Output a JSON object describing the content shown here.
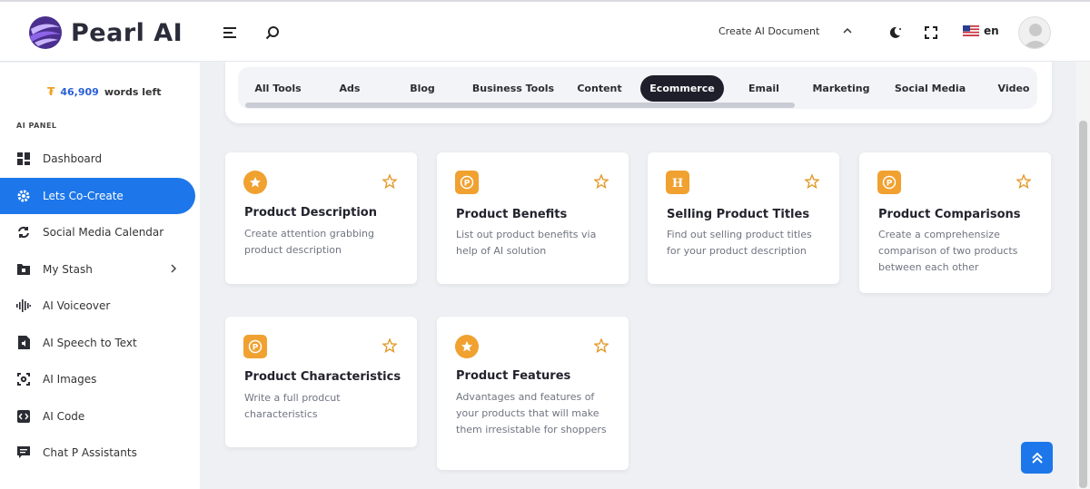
{
  "brand": {
    "name": "Pearl AI"
  },
  "header": {
    "create_document": "Create AI Document",
    "language": "en"
  },
  "sidebar": {
    "words_count": "46,909",
    "words_label": "words left",
    "panel_title": "AI PANEL",
    "items": [
      {
        "label": "Dashboard",
        "icon": "dashboard-icon",
        "active": false
      },
      {
        "label": "Lets Co-Create",
        "icon": "gear-icon",
        "active": true
      },
      {
        "label": "Social Media Calendar",
        "icon": "refresh-icon",
        "active": false
      },
      {
        "label": "My Stash",
        "icon": "folder-icon",
        "active": false
      },
      {
        "label": "AI Voiceover",
        "icon": "waveform-icon",
        "active": false
      },
      {
        "label": "AI Speech to Text",
        "icon": "file-audio-icon",
        "active": false
      },
      {
        "label": "AI Images",
        "icon": "image-scan-icon",
        "active": false
      },
      {
        "label": "AI Code",
        "icon": "code-icon",
        "active": false
      },
      {
        "label": "Chat P Assistants",
        "icon": "chat-icon",
        "active": false
      }
    ]
  },
  "tabs": [
    "All Tools",
    "Ads",
    "Blog",
    "Business Tools",
    "Content",
    "Ecommerce",
    "Email",
    "Marketing",
    "Social Media",
    "Video"
  ],
  "active_tab": "Ecommerce",
  "cards": [
    {
      "title": "Product Description",
      "desc": "Create attention grabbing product description",
      "icon": "star-badge-icon"
    },
    {
      "title": "Product Benefits",
      "desc": "List out product benefits via help of AI solution",
      "icon": "p-badge-icon"
    },
    {
      "title": "Selling Product Titles",
      "desc": "Find out selling product titles for your product description",
      "icon": "h-badge-icon"
    },
    {
      "title": "Product Comparisons",
      "desc": "Create a comprehensize comparison of two products between each other",
      "icon": "p-badge-icon"
    },
    {
      "title": "Product Characteristics",
      "desc": "Write a full prodcut characteristics",
      "icon": "p-badge-icon"
    },
    {
      "title": "Product Features",
      "desc": "Advantages and features of your products that will make them irresistable for shoppers",
      "icon": "star-badge-icon"
    }
  ],
  "colors": {
    "accent": "#1d77ea",
    "icon_orange": "#f0a130",
    "active_tab": "#1e1f2b"
  }
}
